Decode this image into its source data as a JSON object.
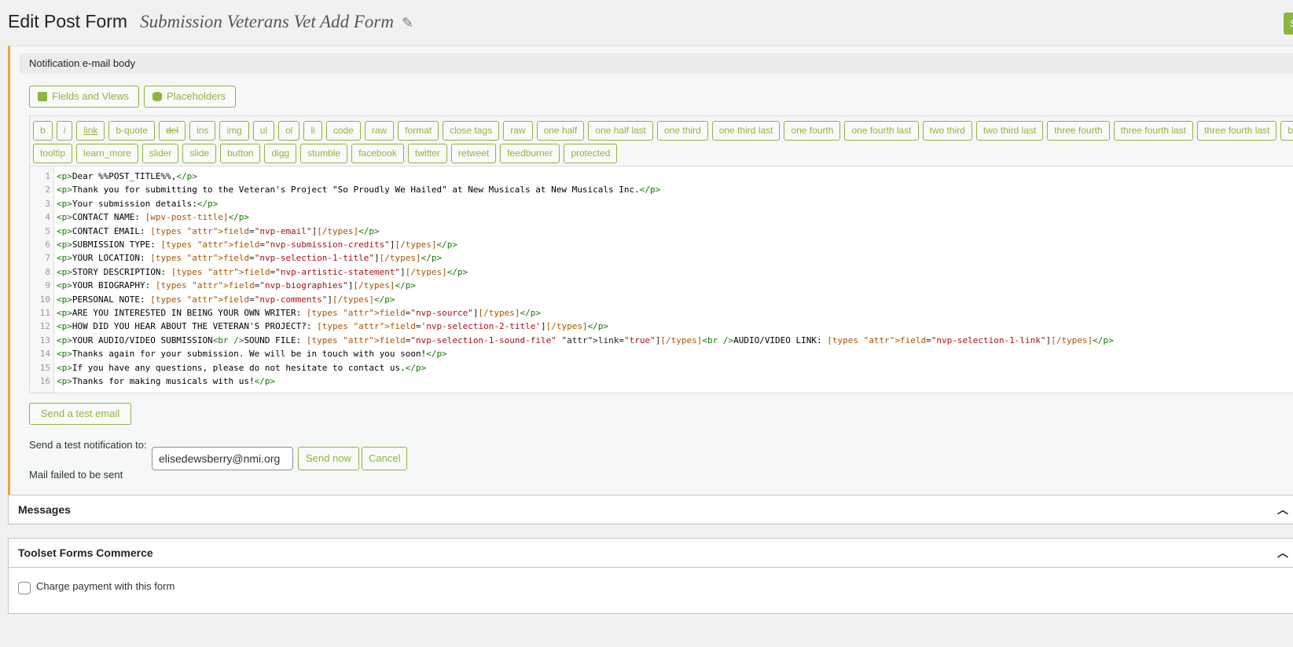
{
  "header": {
    "title": "Edit Post Form",
    "form_name": "Submission Veterans Vet Add Form",
    "save_label": "S"
  },
  "notification": {
    "title": "Notification e-mail body",
    "fields_views_label": "Fields and Views",
    "placeholders_label": "Placeholders"
  },
  "quicktags": {
    "row1": [
      "b",
      "i",
      "link",
      "b-quote",
      "del",
      "ins",
      "img",
      "ul",
      "ol",
      "li",
      "code",
      "raw",
      "format",
      "close tags",
      "raw",
      "one half",
      "one half last",
      "one third",
      "one third last",
      "one fourth",
      "one fourth last",
      "two third",
      "two third last",
      "three fourth",
      "three fourth last",
      "three fourth last",
      "bo"
    ],
    "row2": [
      "tooltip",
      "learn_more",
      "slider",
      "slide",
      "button",
      "digg",
      "stumble",
      "facebook",
      "twitter",
      "retweet",
      "feedburner",
      "protected"
    ]
  },
  "code": {
    "lines": [
      "<p>Dear %%POST_TITLE%%,</p>",
      "<p>Thank you for submitting to the Veteran's Project \"So Proudly We Hailed\" at New Musicals at New Musicals Inc.</p>",
      "<p>Your submission details:</p>",
      "<p>CONTACT NAME: [wpv-post-title]</p>",
      "<p>CONTACT EMAIL: [types field=\"nvp-email\"][/types]</p>",
      "<p>SUBMISSION TYPE: [types field=\"nvp-submission-credits\"][/types]</p>",
      "<p>YOUR LOCATION: [types field=\"nvp-selection-1-title\"][/types]</p>",
      "<p>STORY DESCRIPTION: [types field=\"nvp-artistic-statement\"][/types]</p>",
      "<p>YOUR BIOGRAPHY: [types field=\"nvp-biographies\"][/types]</p>",
      "<p>PERSONAL NOTE: [types field=\"nvp-comments\"][/types]</p>",
      "<p>ARE YOU INTERESTED IN BEING YOUR OWN WRITER: [types field=\"nvp-source\"][/types]</p>",
      "<p>HOW DID YOU HEAR ABOUT THE VETERAN'S PROJECT?: [types field='nvp-selection-2-title'][/types]</p>",
      "<p>YOUR AUDIO/VIDEO SUBMISSION<br />SOUND FILE: [types field=\"nvp-selection-1-sound-file\" link=\"true\"][/types]<br />AUDIO/VIDEO LINK: [types field=\"nvp-selection-1-link\"][/types]</p>",
      "<p>Thanks again for your submission. We will be in touch with you soon!</p>",
      "<p>If you have any questions, please do not hesitate to contact us.</p>",
      "<p>Thanks for making musicals with us!</p>"
    ]
  },
  "test_email": {
    "button_label": "Send a test email",
    "label": "Send a test notification to:",
    "input_value": "elisedewsberry@nmi.org",
    "send_label": "Send now",
    "cancel_label": "Cancel",
    "status": "Mail failed to be sent"
  },
  "panels": {
    "messages_title": "Messages",
    "commerce_title": "Toolset Forms Commerce",
    "charge_label": "Charge payment with this form"
  },
  "colors": {
    "accent": "#8bb63f",
    "notice_border": "#f0a13a"
  }
}
